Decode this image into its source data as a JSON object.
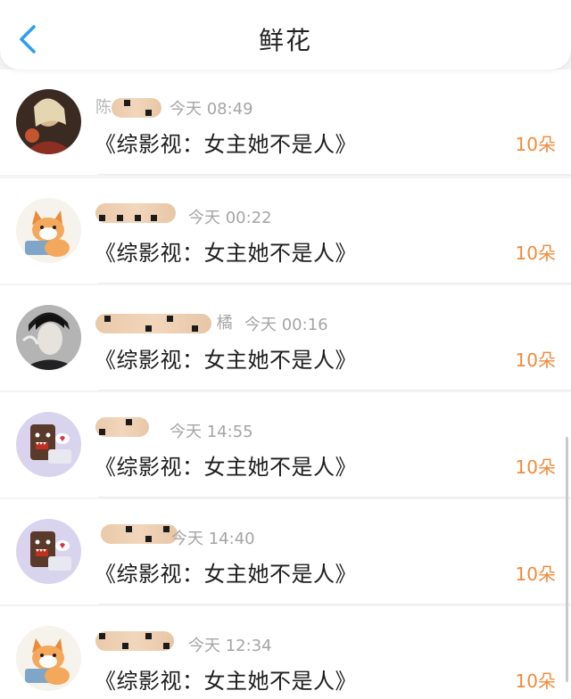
{
  "header": {
    "title": "鲜花"
  },
  "colors": {
    "accent_blue": "#2d9ef0",
    "count_orange": "#ef8a3b"
  },
  "items": [
    {
      "name_visible": "陈",
      "time": "今天 08:49",
      "book": "《综影视：女主她不是人》",
      "count": "10朵",
      "avatar": "portrait-icon"
    },
    {
      "name_visible": "",
      "time": "今天 00:22",
      "book": "《综影视：女主她不是人》",
      "count": "10朵",
      "avatar": "cat-icon"
    },
    {
      "name_visible": "橘",
      "time": "今天 00:16",
      "book": "《综影视：女主她不是人》",
      "count": "10朵",
      "avatar": "portrait-icon"
    },
    {
      "name_visible": "",
      "time": "今天 14:55",
      "book": "《综影视：女主她不是人》",
      "count": "10朵",
      "avatar": "domo-icon"
    },
    {
      "name_visible": "",
      "time": "今天 14:40",
      "book": "《综影视：女主她不是人》",
      "count": "10朵",
      "avatar": "domo-icon"
    },
    {
      "name_visible": "",
      "time": "今天 12:34",
      "book": "《综影视：女主她不是人》",
      "count": "10朵",
      "avatar": "cat-icon"
    }
  ]
}
